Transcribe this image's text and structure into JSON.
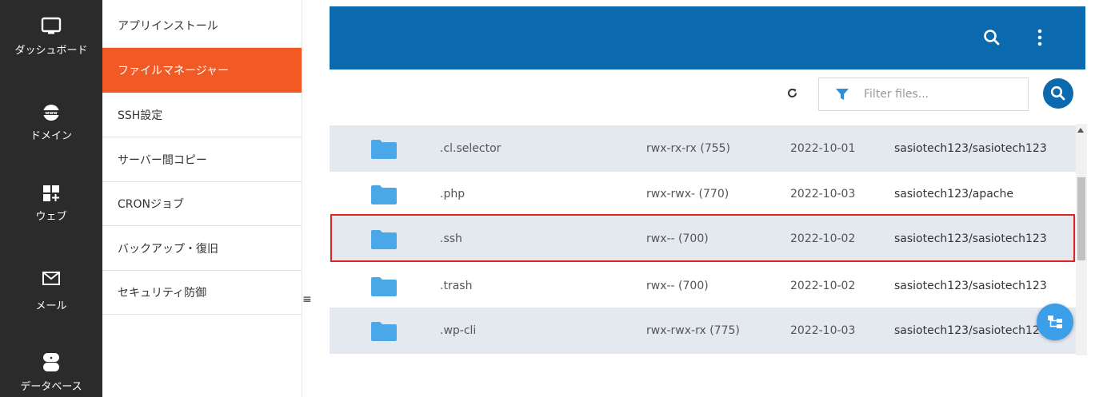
{
  "rail": {
    "items": [
      {
        "label": "ダッシュボード",
        "icon": "monitor-icon"
      },
      {
        "label": "ドメイン",
        "icon": "globe-www-icon"
      },
      {
        "label": "ウェブ",
        "icon": "grid-plus-icon"
      },
      {
        "label": "メール",
        "icon": "envelope-icon"
      },
      {
        "label": "データベース",
        "icon": "database-icon"
      }
    ]
  },
  "submenu": {
    "items": [
      {
        "label": "アプリインストール"
      },
      {
        "label": "ファイルマネージャー",
        "active": true
      },
      {
        "label": "SSH設定"
      },
      {
        "label": "サーバー間コピー"
      },
      {
        "label": "CRONジョブ"
      },
      {
        "label": "バックアップ・復旧"
      },
      {
        "label": "セキュリティ防御"
      }
    ],
    "toggle_symbol": "≡"
  },
  "toolbar": {
    "refresh_symbol": "C",
    "filter_placeholder": "Filter files..."
  },
  "files": [
    {
      "name": ".cl.selector",
      "perms": "rwx-rx-rx (755)",
      "date": "2022-10-01",
      "owner": "sasiotech123/sasiotech123"
    },
    {
      "name": ".php",
      "perms": "rwx-rwx- (770)",
      "date": "2022-10-03",
      "owner": "sasiotech123/apache"
    },
    {
      "name": ".ssh",
      "perms": "rwx-- (700)",
      "date": "2022-10-02",
      "owner": "sasiotech123/sasiotech123"
    },
    {
      "name": ".trash",
      "perms": "rwx-- (700)",
      "date": "2022-10-02",
      "owner": "sasiotech123/sasiotech123"
    },
    {
      "name": ".wp-cli",
      "perms": "rwx-rwx-rx (775)",
      "date": "2022-10-03",
      "owner": "sasiotech123/sasiotech123"
    }
  ],
  "colors": {
    "accent_orange": "#f15a24",
    "brand_blue": "#0b6aad",
    "folder_blue": "#4aa8e8",
    "highlight_red": "#e02424"
  }
}
